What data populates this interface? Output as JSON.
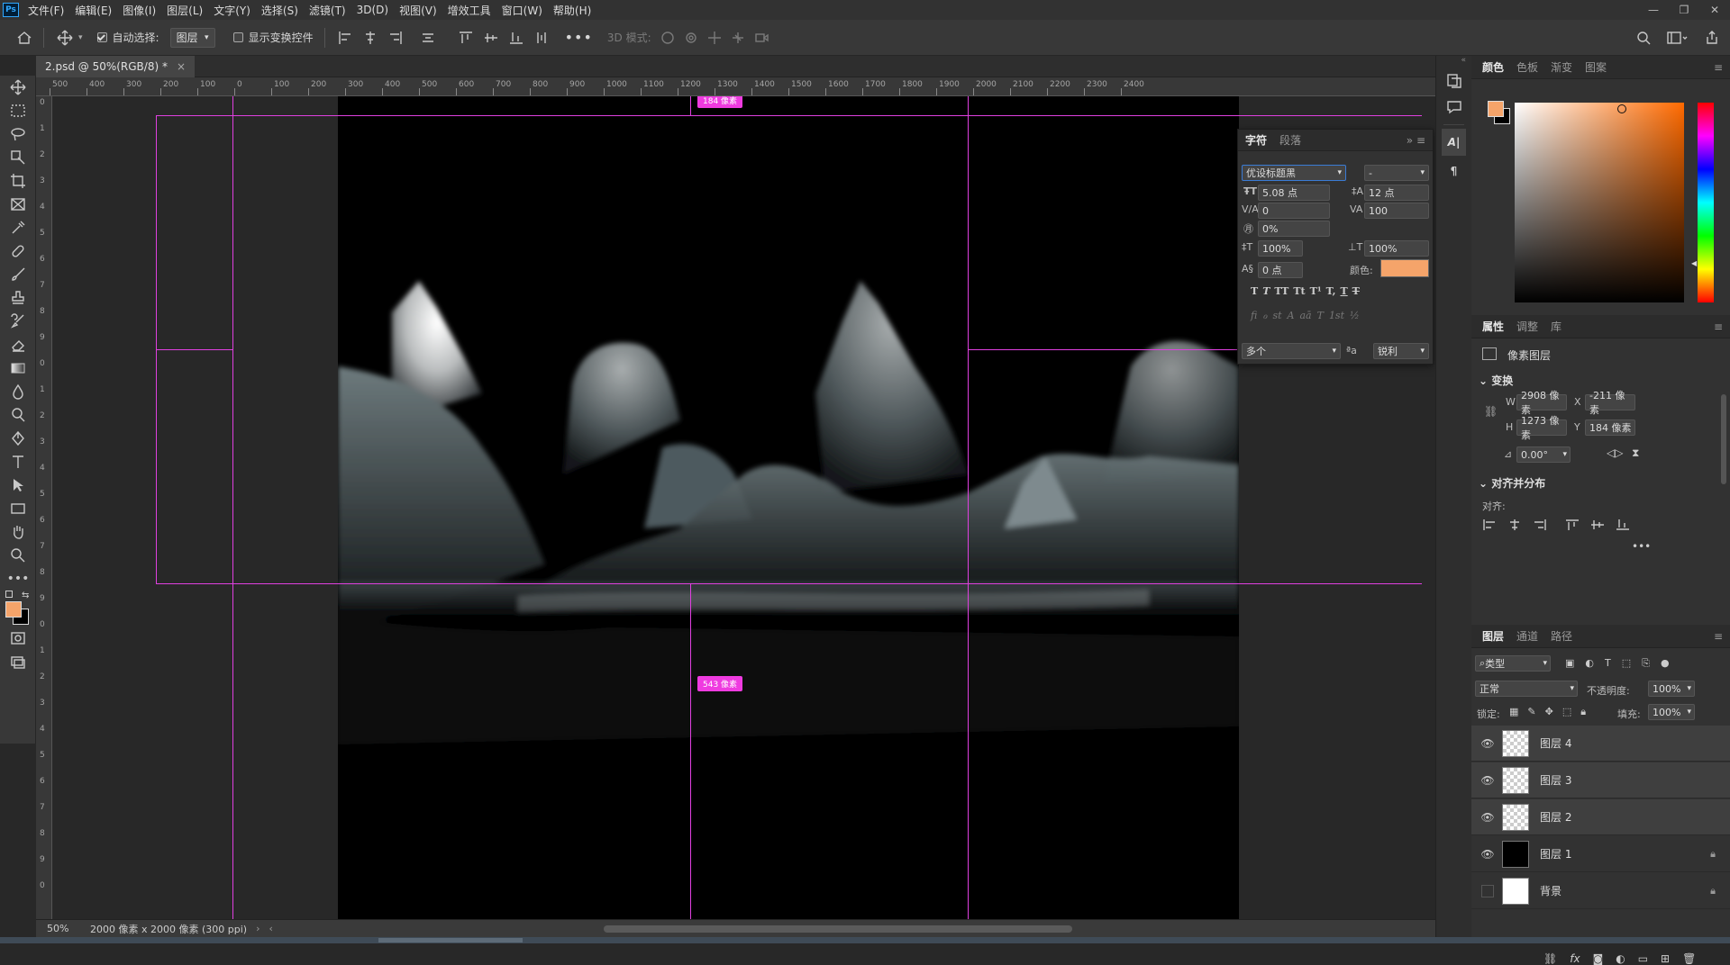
{
  "menubar": {
    "logo": "Ps",
    "items": [
      "文件(F)",
      "编辑(E)",
      "图像(I)",
      "图层(L)",
      "文字(Y)",
      "选择(S)",
      "滤镜(T)",
      "3D(D)",
      "视图(V)",
      "增效工具",
      "窗口(W)",
      "帮助(H)"
    ]
  },
  "options": {
    "auto_select_label": "自动选择:",
    "auto_select_value": "图层",
    "show_transform_label": "显示变换控件",
    "mode_3d_label": "3D 模式:"
  },
  "document": {
    "tab_title": "2.psd @ 50%(RGB/8) *",
    "zoom": "50%",
    "doc_info": "2000 像素 x 2000 像素 (300 ppi)",
    "top_badge": "184 像素",
    "bottom_badge": "543 像素"
  },
  "ruler": {
    "h_ticks": [
      "500",
      "400",
      "300",
      "200",
      "100",
      "0",
      "100",
      "200",
      "300",
      "400",
      "500",
      "600",
      "700",
      "800",
      "900",
      "1000",
      "1100",
      "1200",
      "1300",
      "1400",
      "1500",
      "1600",
      "1700",
      "1800",
      "1900",
      "2000",
      "2100",
      "2200",
      "2300",
      "2400"
    ],
    "v_ticks": [
      "0",
      "1",
      "2",
      "3",
      "4",
      "5",
      "6",
      "7",
      "8",
      "9",
      "0",
      "1",
      "2",
      "3",
      "4",
      "5",
      "6",
      "7",
      "8",
      "9",
      "0",
      "1",
      "2",
      "3",
      "4",
      "5",
      "6",
      "7",
      "8",
      "9",
      "0"
    ]
  },
  "character_panel": {
    "tabs": [
      "字符",
      "段落"
    ],
    "font_family": "优设标题黑",
    "font_style": "-",
    "font_size": "5.08 点",
    "leading": "12 点",
    "kerning": "0",
    "tracking": "100",
    "tsume": "0%",
    "vscale": "100%",
    "hscale": "100%",
    "baseline": "0 点",
    "color_label": "颜色:",
    "color": "#f5a46a",
    "styles": [
      "T",
      "T",
      "TT",
      "Tt",
      "T¹",
      "T,",
      "T",
      "T"
    ],
    "opentype": [
      "fi",
      "ℴ",
      "st",
      "A",
      "aā",
      "T",
      "1st",
      "½"
    ],
    "language": "多个",
    "aa_label": "ªa",
    "antialias": "锐利"
  },
  "color_panel": {
    "tabs": [
      "颜色",
      "色板",
      "渐变",
      "图案"
    ],
    "foreground": "#f5a46a",
    "background": "#000000",
    "hue": "#ff6a00"
  },
  "properties_panel": {
    "tabs": [
      "属性",
      "调整",
      "库"
    ],
    "layer_type": "像素图层",
    "transform_title": "变换",
    "w_label": "W",
    "w": "2908 像素",
    "x_label": "X",
    "x": "-211 像素",
    "h_label": "H",
    "h": "1273 像素",
    "y_label": "Y",
    "y": "184 像素",
    "angle": "0.00°",
    "align_title": "对齐并分布",
    "align_label": "对齐:"
  },
  "layers_panel": {
    "tabs": [
      "图层",
      "通道",
      "路径"
    ],
    "filter": "类型",
    "blend_mode": "正常",
    "opacity_label": "不透明度:",
    "opacity": "100%",
    "lock_label": "锁定:",
    "fill_label": "填充:",
    "fill": "100%",
    "layers": [
      {
        "name": "图层 4",
        "visible": true,
        "selected": true,
        "thumb": "checker",
        "locked": false
      },
      {
        "name": "图层 3",
        "visible": true,
        "selected": true,
        "thumb": "checker",
        "locked": false
      },
      {
        "name": "图层 2",
        "visible": true,
        "selected": true,
        "thumb": "checker",
        "locked": false
      },
      {
        "name": "图层 1",
        "visible": true,
        "selected": false,
        "thumb": "black",
        "locked": true
      },
      {
        "name": "背景",
        "visible": false,
        "selected": false,
        "thumb": "white",
        "locked": true
      }
    ]
  },
  "colors": {
    "guide": "#e040e0",
    "badge": "#ef3be0",
    "accent": "#31a8ff"
  }
}
